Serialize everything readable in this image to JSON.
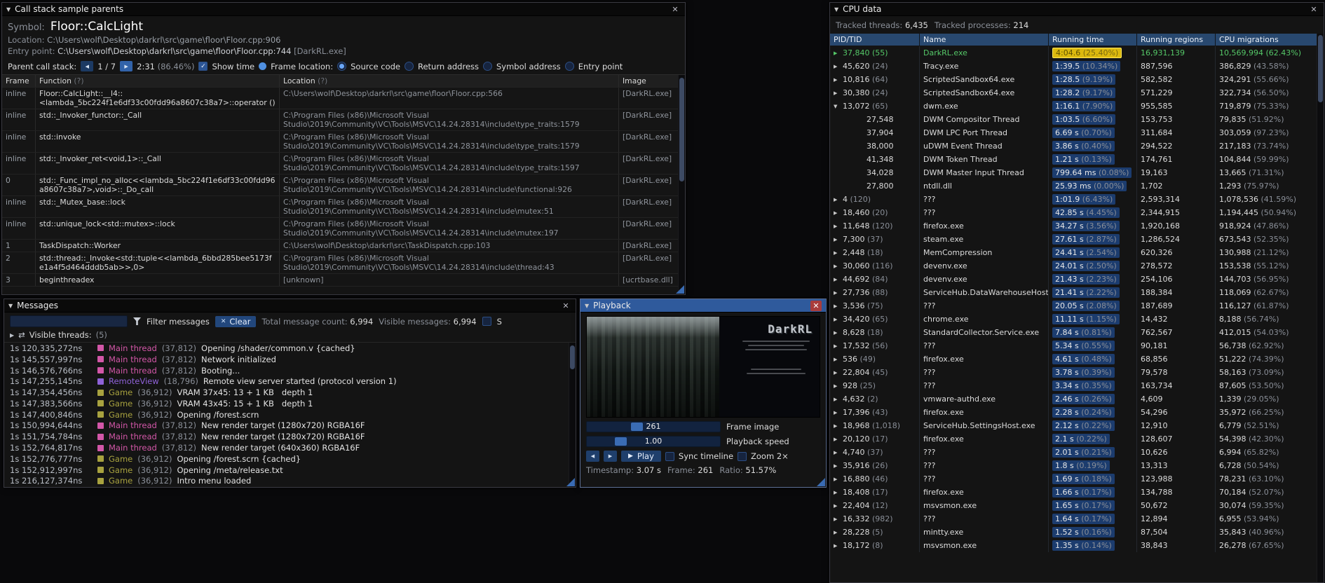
{
  "icons": {
    "collapse": "▼",
    "close": "✕",
    "prev": "◀",
    "next": "▶",
    "play": "▶",
    "check": "✓",
    "shuffle": "⇄",
    "expand": "▶",
    "clear": "✕"
  },
  "callstack": {
    "title": "Call stack sample parents",
    "symbol_label": "Symbol:",
    "symbol": "Floor::CalcLight",
    "location_label": "Location:",
    "location": "C:\\Users\\wolf\\Desktop\\darkrl\\src\\game\\floor\\Floor.cpp:906",
    "entry_label": "Entry point:",
    "entry": "C:\\Users\\wolf\\Desktop\\darkrl\\src\\game\\floor\\Floor.cpp:744",
    "entry_image": "[DarkRL.exe]",
    "parent_label": "Parent call stack:",
    "nav_pos": "1 / 7",
    "sample_time": "2:31",
    "sample_pct": "(86.46%)",
    "show_time_label": "Show time",
    "frame_location_label": "Frame location:",
    "radio_source": "Source code",
    "radio_return": "Return address",
    "radio_symbol": "Symbol address",
    "radio_entry": "Entry point",
    "headers": [
      "Frame",
      "Function",
      "Location",
      "Image"
    ],
    "hint": "(?)",
    "rows": [
      {
        "frame": "inline",
        "function": "Floor::CalcLight::__l4::<lambda_5bc224f1e6df33c00fdd96a8607c38a7>::operator ()",
        "location": "C:\\Users\\wolf\\Desktop\\darkrl\\src\\game\\floor\\Floor.cpp:566",
        "image": "[DarkRL.exe]"
      },
      {
        "frame": "inline",
        "function": "std::_Invoker_functor::_Call",
        "location": "C:\\Program Files (x86)\\Microsoft Visual Studio\\2019\\Community\\VC\\Tools\\MSVC\\14.24.28314\\include\\type_traits:1579",
        "image": "[DarkRL.exe]"
      },
      {
        "frame": "inline",
        "function": "std::invoke",
        "location": "C:\\Program Files (x86)\\Microsoft Visual Studio\\2019\\Community\\VC\\Tools\\MSVC\\14.24.28314\\include\\type_traits:1579",
        "image": "[DarkRL.exe]"
      },
      {
        "frame": "inline",
        "function": "std::_Invoker_ret<void,1>::_Call",
        "location": "C:\\Program Files (x86)\\Microsoft Visual Studio\\2019\\Community\\VC\\Tools\\MSVC\\14.24.28314\\include\\type_traits:1597",
        "image": "[DarkRL.exe]"
      },
      {
        "frame": "0",
        "function": "std::_Func_impl_no_alloc<<lambda_5bc224f1e6df33c00fdd96a8607c38a7>,void>::_Do_call",
        "location": "C:\\Program Files (x86)\\Microsoft Visual Studio\\2019\\Community\\VC\\Tools\\MSVC\\14.24.28314\\include\\functional:926",
        "image": "[DarkRL.exe]"
      },
      {
        "frame": "inline",
        "function": "std::_Mutex_base::lock",
        "location": "C:\\Program Files (x86)\\Microsoft Visual Studio\\2019\\Community\\VC\\Tools\\MSVC\\14.24.28314\\include\\mutex:51",
        "image": "[DarkRL.exe]"
      },
      {
        "frame": "inline",
        "function": "std::unique_lock<std::mutex>::lock",
        "location": "C:\\Program Files (x86)\\Microsoft Visual Studio\\2019\\Community\\VC\\Tools\\MSVC\\14.24.28314\\include\\mutex:197",
        "image": "[DarkRL.exe]"
      },
      {
        "frame": "1",
        "function": "TaskDispatch::Worker",
        "location": "C:\\Users\\wolf\\Desktop\\darkrl\\src\\TaskDispatch.cpp:103",
        "image": "[DarkRL.exe]"
      },
      {
        "frame": "2",
        "function": "std::thread::_Invoke<std::tuple<<lambda_6bbd285bee5173fe1a4f5d464dddb5ab>>,0>",
        "location": "C:\\Program Files (x86)\\Microsoft Visual Studio\\2019\\Community\\VC\\Tools\\MSVC\\14.24.28314\\include\\thread:43",
        "image": "[DarkRL.exe]"
      },
      {
        "frame": "3",
        "function": "beginthreadex",
        "location": "[unknown]",
        "image": "[ucrtbase.dll]"
      }
    ]
  },
  "messages": {
    "title": "Messages",
    "filter_label": "Filter messages",
    "clear_label": "Clear",
    "total_label": "Total message count:",
    "total": "6,994",
    "visible_label": "Visible messages:",
    "visible": "6,994",
    "clipped_label": "S",
    "threads_label": "Visible threads:",
    "threads_count": "(5)",
    "thread_colors": {
      "main": "#d357a8",
      "remote": "#8f62d8",
      "game": "#a8a23f"
    },
    "rows": [
      {
        "time": "1s 120,335,272ns",
        "thread": "Main thread",
        "tid": "(37,812)",
        "color": "#d357a8",
        "text": "Opening /shader/common.v {cached}"
      },
      {
        "time": "1s 145,557,997ns",
        "thread": "Main thread",
        "tid": "(37,812)",
        "color": "#d357a8",
        "text": "Network initialized"
      },
      {
        "time": "1s 146,576,766ns",
        "thread": "Main thread",
        "tid": "(37,812)",
        "color": "#d357a8",
        "text": "Booting..."
      },
      {
        "time": "1s 147,255,145ns",
        "thread": "RemoteView",
        "tid": "(18,796)",
        "color": "#8f62d8",
        "text": "Remote view server started (protocol version 1)"
      },
      {
        "time": "1s 147,354,456ns",
        "thread": "Game",
        "tid": "(36,912)",
        "color": "#a8a23f",
        "text": "VRAM 37x45: 13 + 1 KB   depth 1"
      },
      {
        "time": "1s 147,383,566ns",
        "thread": "Game",
        "tid": "(36,912)",
        "color": "#a8a23f",
        "text": "VRAM 43x45: 15 + 1 KB   depth 1"
      },
      {
        "time": "1s 147,400,846ns",
        "thread": "Game",
        "tid": "(36,912)",
        "color": "#a8a23f",
        "text": "Opening /forest.scrn"
      },
      {
        "time": "1s 150,994,644ns",
        "thread": "Main thread",
        "tid": "(37,812)",
        "color": "#d357a8",
        "text": "New render target (1280x720) RGBA16F"
      },
      {
        "time": "1s 151,754,784ns",
        "thread": "Main thread",
        "tid": "(37,812)",
        "color": "#d357a8",
        "text": "New render target (1280x720) RGBA16F"
      },
      {
        "time": "1s 152,764,817ns",
        "thread": "Main thread",
        "tid": "(37,812)",
        "color": "#d357a8",
        "text": "New render target (640x360) RGBA16F"
      },
      {
        "time": "1s 152,776,777ns",
        "thread": "Game",
        "tid": "(36,912)",
        "color": "#a8a23f",
        "text": "Opening /forest.scrn {cached}"
      },
      {
        "time": "1s 152,912,997ns",
        "thread": "Game",
        "tid": "(36,912)",
        "color": "#a8a23f",
        "text": "Opening /meta/release.txt"
      },
      {
        "time": "1s 216,127,374ns",
        "thread": "Game",
        "tid": "(36,912)",
        "color": "#a8a23f",
        "text": "Intro menu loaded"
      }
    ]
  },
  "playback": {
    "title": "Playback",
    "logo": "DarkRL",
    "frame_value": "261",
    "frame_label": "Frame image",
    "speed_value": "1.00",
    "speed_label": "Playback speed",
    "play_label": "Play",
    "sync_label": "Sync timeline",
    "zoom_label": "Zoom 2×",
    "timestamp_label": "Timestamp:",
    "timestamp": "3.07 s",
    "frame_no_label": "Frame:",
    "frame_no": "261",
    "ratio_label": "Ratio:",
    "ratio": "51.57%"
  },
  "cpu": {
    "title": "CPU data",
    "tracked_threads_label": "Tracked threads:",
    "tracked_threads": "6,435",
    "tracked_processes_label": "Tracked processes:",
    "tracked_processes": "214",
    "headers": [
      "PID/TID",
      "Name",
      "Running time",
      "Running regions",
      "CPU migrations"
    ],
    "colors": {
      "profiled_green": "#55c868",
      "bar_blue": "#1c3c6e",
      "highlight": "#dcb90e"
    },
    "rows": [
      {
        "arrow": "▶",
        "pid": "37,840",
        "cnt": "(55)",
        "name": "DarkRL.exe",
        "time": "4:04.6",
        "pct": "(25.40%)",
        "regions": "16,931,139",
        "migrations": "10,569,994",
        "mpct": "(62.43%)",
        "green": true,
        "hl": true
      },
      {
        "arrow": "▶",
        "pid": "45,620",
        "cnt": "(24)",
        "name": "Tracy.exe",
        "time": "1:39.5",
        "pct": "(10.34%)",
        "regions": "887,596",
        "migrations": "386,829",
        "mpct": "(43.58%)"
      },
      {
        "arrow": "▶",
        "pid": "10,816",
        "cnt": "(64)",
        "name": "ScriptedSandbox64.exe",
        "time": "1:28.5",
        "pct": "(9.19%)",
        "regions": "582,582",
        "migrations": "324,291",
        "mpct": "(55.66%)"
      },
      {
        "arrow": "▶",
        "pid": "30,380",
        "cnt": "(24)",
        "name": "ScriptedSandbox64.exe",
        "time": "1:28.2",
        "pct": "(9.17%)",
        "regions": "571,229",
        "migrations": "322,734",
        "mpct": "(56.50%)"
      },
      {
        "arrow": "▼",
        "pid": "13,072",
        "cnt": "(65)",
        "name": "dwm.exe",
        "time": "1:16.1",
        "pct": "(7.90%)",
        "regions": "955,585",
        "migrations": "719,879",
        "mpct": "(75.33%)"
      },
      {
        "child": true,
        "pid": "27,548",
        "name": "DWM Compositor Thread",
        "time": "1:03.5",
        "pct": "(6.60%)",
        "regions": "153,753",
        "migrations": "79,835",
        "mpct": "(51.92%)"
      },
      {
        "child": true,
        "pid": "37,904",
        "name": "DWM LPC Port Thread",
        "time": "6.69 s",
        "pct": "(0.70%)",
        "regions": "311,684",
        "migrations": "303,059",
        "mpct": "(97.23%)"
      },
      {
        "child": true,
        "pid": "38,000",
        "name": "uDWM Event Thread",
        "time": "3.86 s",
        "pct": "(0.40%)",
        "regions": "294,522",
        "migrations": "217,183",
        "mpct": "(73.74%)"
      },
      {
        "child": true,
        "pid": "41,348",
        "name": "DWM Token Thread",
        "time": "1.21 s",
        "pct": "(0.13%)",
        "regions": "174,761",
        "migrations": "104,844",
        "mpct": "(59.99%)"
      },
      {
        "child": true,
        "pid": "34,028",
        "name": "DWM Master Input Thread",
        "time": "799.64 ms",
        "pct": "(0.08%)",
        "regions": "19,163",
        "migrations": "13,665",
        "mpct": "(71.31%)"
      },
      {
        "child": true,
        "pid": "27,800",
        "name": "ntdll.dll",
        "time": "25.93 ms",
        "pct": "(0.00%)",
        "regions": "1,702",
        "migrations": "1,293",
        "mpct": "(75.97%)"
      },
      {
        "arrow": "▶",
        "pid": "4",
        "cnt": "(120)",
        "name": "???",
        "time": "1:01.9",
        "pct": "(6.43%)",
        "regions": "2,593,314",
        "migrations": "1,078,536",
        "mpct": "(41.59%)"
      },
      {
        "arrow": "▶",
        "pid": "18,460",
        "cnt": "(20)",
        "name": "???",
        "time": "42.85 s",
        "pct": "(4.45%)",
        "regions": "2,344,915",
        "migrations": "1,194,445",
        "mpct": "(50.94%)"
      },
      {
        "arrow": "▶",
        "pid": "11,648",
        "cnt": "(120)",
        "name": "firefox.exe",
        "time": "34.27 s",
        "pct": "(3.56%)",
        "regions": "1,920,168",
        "migrations": "918,924",
        "mpct": "(47.86%)"
      },
      {
        "arrow": "▶",
        "pid": "7,300",
        "cnt": "(37)",
        "name": "steam.exe",
        "time": "27.61 s",
        "pct": "(2.87%)",
        "regions": "1,286,524",
        "migrations": "673,543",
        "mpct": "(52.35%)"
      },
      {
        "arrow": "▶",
        "pid": "2,448",
        "cnt": "(18)",
        "name": "MemCompression",
        "time": "24.41 s",
        "pct": "(2.54%)",
        "regions": "620,326",
        "migrations": "130,988",
        "mpct": "(21.12%)"
      },
      {
        "arrow": "▶",
        "pid": "30,060",
        "cnt": "(116)",
        "name": "devenv.exe",
        "time": "24.01 s",
        "pct": "(2.50%)",
        "regions": "278,572",
        "migrations": "153,538",
        "mpct": "(55.12%)"
      },
      {
        "arrow": "▶",
        "pid": "44,692",
        "cnt": "(84)",
        "name": "devenv.exe",
        "time": "21.43 s",
        "pct": "(2.23%)",
        "regions": "254,106",
        "migrations": "144,703",
        "mpct": "(56.95%)"
      },
      {
        "arrow": "▶",
        "pid": "27,736",
        "cnt": "(88)",
        "name": "ServiceHub.DataWarehouseHost.exe",
        "time": "21.41 s",
        "pct": "(2.22%)",
        "regions": "188,384",
        "migrations": "118,069",
        "mpct": "(62.67%)"
      },
      {
        "arrow": "▶",
        "pid": "3,536",
        "cnt": "(75)",
        "name": "???",
        "time": "20.05 s",
        "pct": "(2.08%)",
        "regions": "187,689",
        "migrations": "116,127",
        "mpct": "(61.87%)"
      },
      {
        "arrow": "▶",
        "pid": "34,420",
        "cnt": "(65)",
        "name": "chrome.exe",
        "time": "11.11 s",
        "pct": "(1.15%)",
        "regions": "14,432",
        "migrations": "8,188",
        "mpct": "(56.74%)"
      },
      {
        "arrow": "▶",
        "pid": "8,628",
        "cnt": "(18)",
        "name": "StandardCollector.Service.exe",
        "time": "7.84 s",
        "pct": "(0.81%)",
        "regions": "762,567",
        "migrations": "412,015",
        "mpct": "(54.03%)"
      },
      {
        "arrow": "▶",
        "pid": "17,532",
        "cnt": "(56)",
        "name": "???",
        "time": "5.34 s",
        "pct": "(0.55%)",
        "regions": "90,181",
        "migrations": "56,738",
        "mpct": "(62.92%)"
      },
      {
        "arrow": "▶",
        "pid": "536",
        "cnt": "(49)",
        "name": "firefox.exe",
        "time": "4.61 s",
        "pct": "(0.48%)",
        "regions": "68,856",
        "migrations": "51,222",
        "mpct": "(74.39%)"
      },
      {
        "arrow": "▶",
        "pid": "22,804",
        "cnt": "(45)",
        "name": "???",
        "time": "3.78 s",
        "pct": "(0.39%)",
        "regions": "79,578",
        "migrations": "58,163",
        "mpct": "(73.09%)"
      },
      {
        "arrow": "▶",
        "pid": "928",
        "cnt": "(25)",
        "name": "???",
        "time": "3.34 s",
        "pct": "(0.35%)",
        "regions": "163,734",
        "migrations": "87,605",
        "mpct": "(53.50%)"
      },
      {
        "arrow": "▶",
        "pid": "4,632",
        "cnt": "(2)",
        "name": "vmware-authd.exe",
        "time": "2.46 s",
        "pct": "(0.26%)",
        "regions": "4,609",
        "migrations": "1,339",
        "mpct": "(29.05%)"
      },
      {
        "arrow": "▶",
        "pid": "17,396",
        "cnt": "(43)",
        "name": "firefox.exe",
        "time": "2.28 s",
        "pct": "(0.24%)",
        "regions": "54,296",
        "migrations": "35,972",
        "mpct": "(66.25%)"
      },
      {
        "arrow": "▶",
        "pid": "18,968",
        "cnt": "(1,018)",
        "name": "ServiceHub.SettingsHost.exe",
        "time": "2.12 s",
        "pct": "(0.22%)",
        "regions": "12,910",
        "migrations": "6,779",
        "mpct": "(52.51%)"
      },
      {
        "arrow": "▶",
        "pid": "20,120",
        "cnt": "(17)",
        "name": "firefox.exe",
        "time": "2.1 s",
        "pct": "(0.22%)",
        "regions": "128,607",
        "migrations": "54,398",
        "mpct": "(42.30%)"
      },
      {
        "arrow": "▶",
        "pid": "4,740",
        "cnt": "(37)",
        "name": "???",
        "time": "2.01 s",
        "pct": "(0.21%)",
        "regions": "10,626",
        "migrations": "6,994",
        "mpct": "(65.82%)"
      },
      {
        "arrow": "▶",
        "pid": "35,916",
        "cnt": "(26)",
        "name": "???",
        "time": "1.8 s",
        "pct": "(0.19%)",
        "regions": "13,313",
        "migrations": "6,728",
        "mpct": "(50.54%)"
      },
      {
        "arrow": "▶",
        "pid": "16,880",
        "cnt": "(46)",
        "name": "???",
        "time": "1.69 s",
        "pct": "(0.18%)",
        "regions": "123,988",
        "migrations": "78,231",
        "mpct": "(63.10%)"
      },
      {
        "arrow": "▶",
        "pid": "18,408",
        "cnt": "(17)",
        "name": "firefox.exe",
        "time": "1.66 s",
        "pct": "(0.17%)",
        "regions": "134,788",
        "migrations": "70,184",
        "mpct": "(52.07%)"
      },
      {
        "arrow": "▶",
        "pid": "22,404",
        "cnt": "(12)",
        "name": "msvsmon.exe",
        "time": "1.65 s",
        "pct": "(0.17%)",
        "regions": "50,672",
        "migrations": "30,074",
        "mpct": "(59.35%)"
      },
      {
        "arrow": "▶",
        "pid": "16,332",
        "cnt": "(982)",
        "name": "???",
        "time": "1.64 s",
        "pct": "(0.17%)",
        "regions": "12,894",
        "migrations": "6,955",
        "mpct": "(53.94%)"
      },
      {
        "arrow": "▶",
        "pid": "28,228",
        "cnt": "(5)",
        "name": "mintty.exe",
        "time": "1.52 s",
        "pct": "(0.16%)",
        "regions": "87,504",
        "migrations": "35,843",
        "mpct": "(40.96%)"
      },
      {
        "arrow": "▶",
        "pid": "18,172",
        "cnt": "(8)",
        "name": "msvsmon.exe",
        "time": "1.35 s",
        "pct": "(0.14%)",
        "regions": "38,843",
        "migrations": "26,278",
        "mpct": "(67.65%)"
      }
    ]
  }
}
